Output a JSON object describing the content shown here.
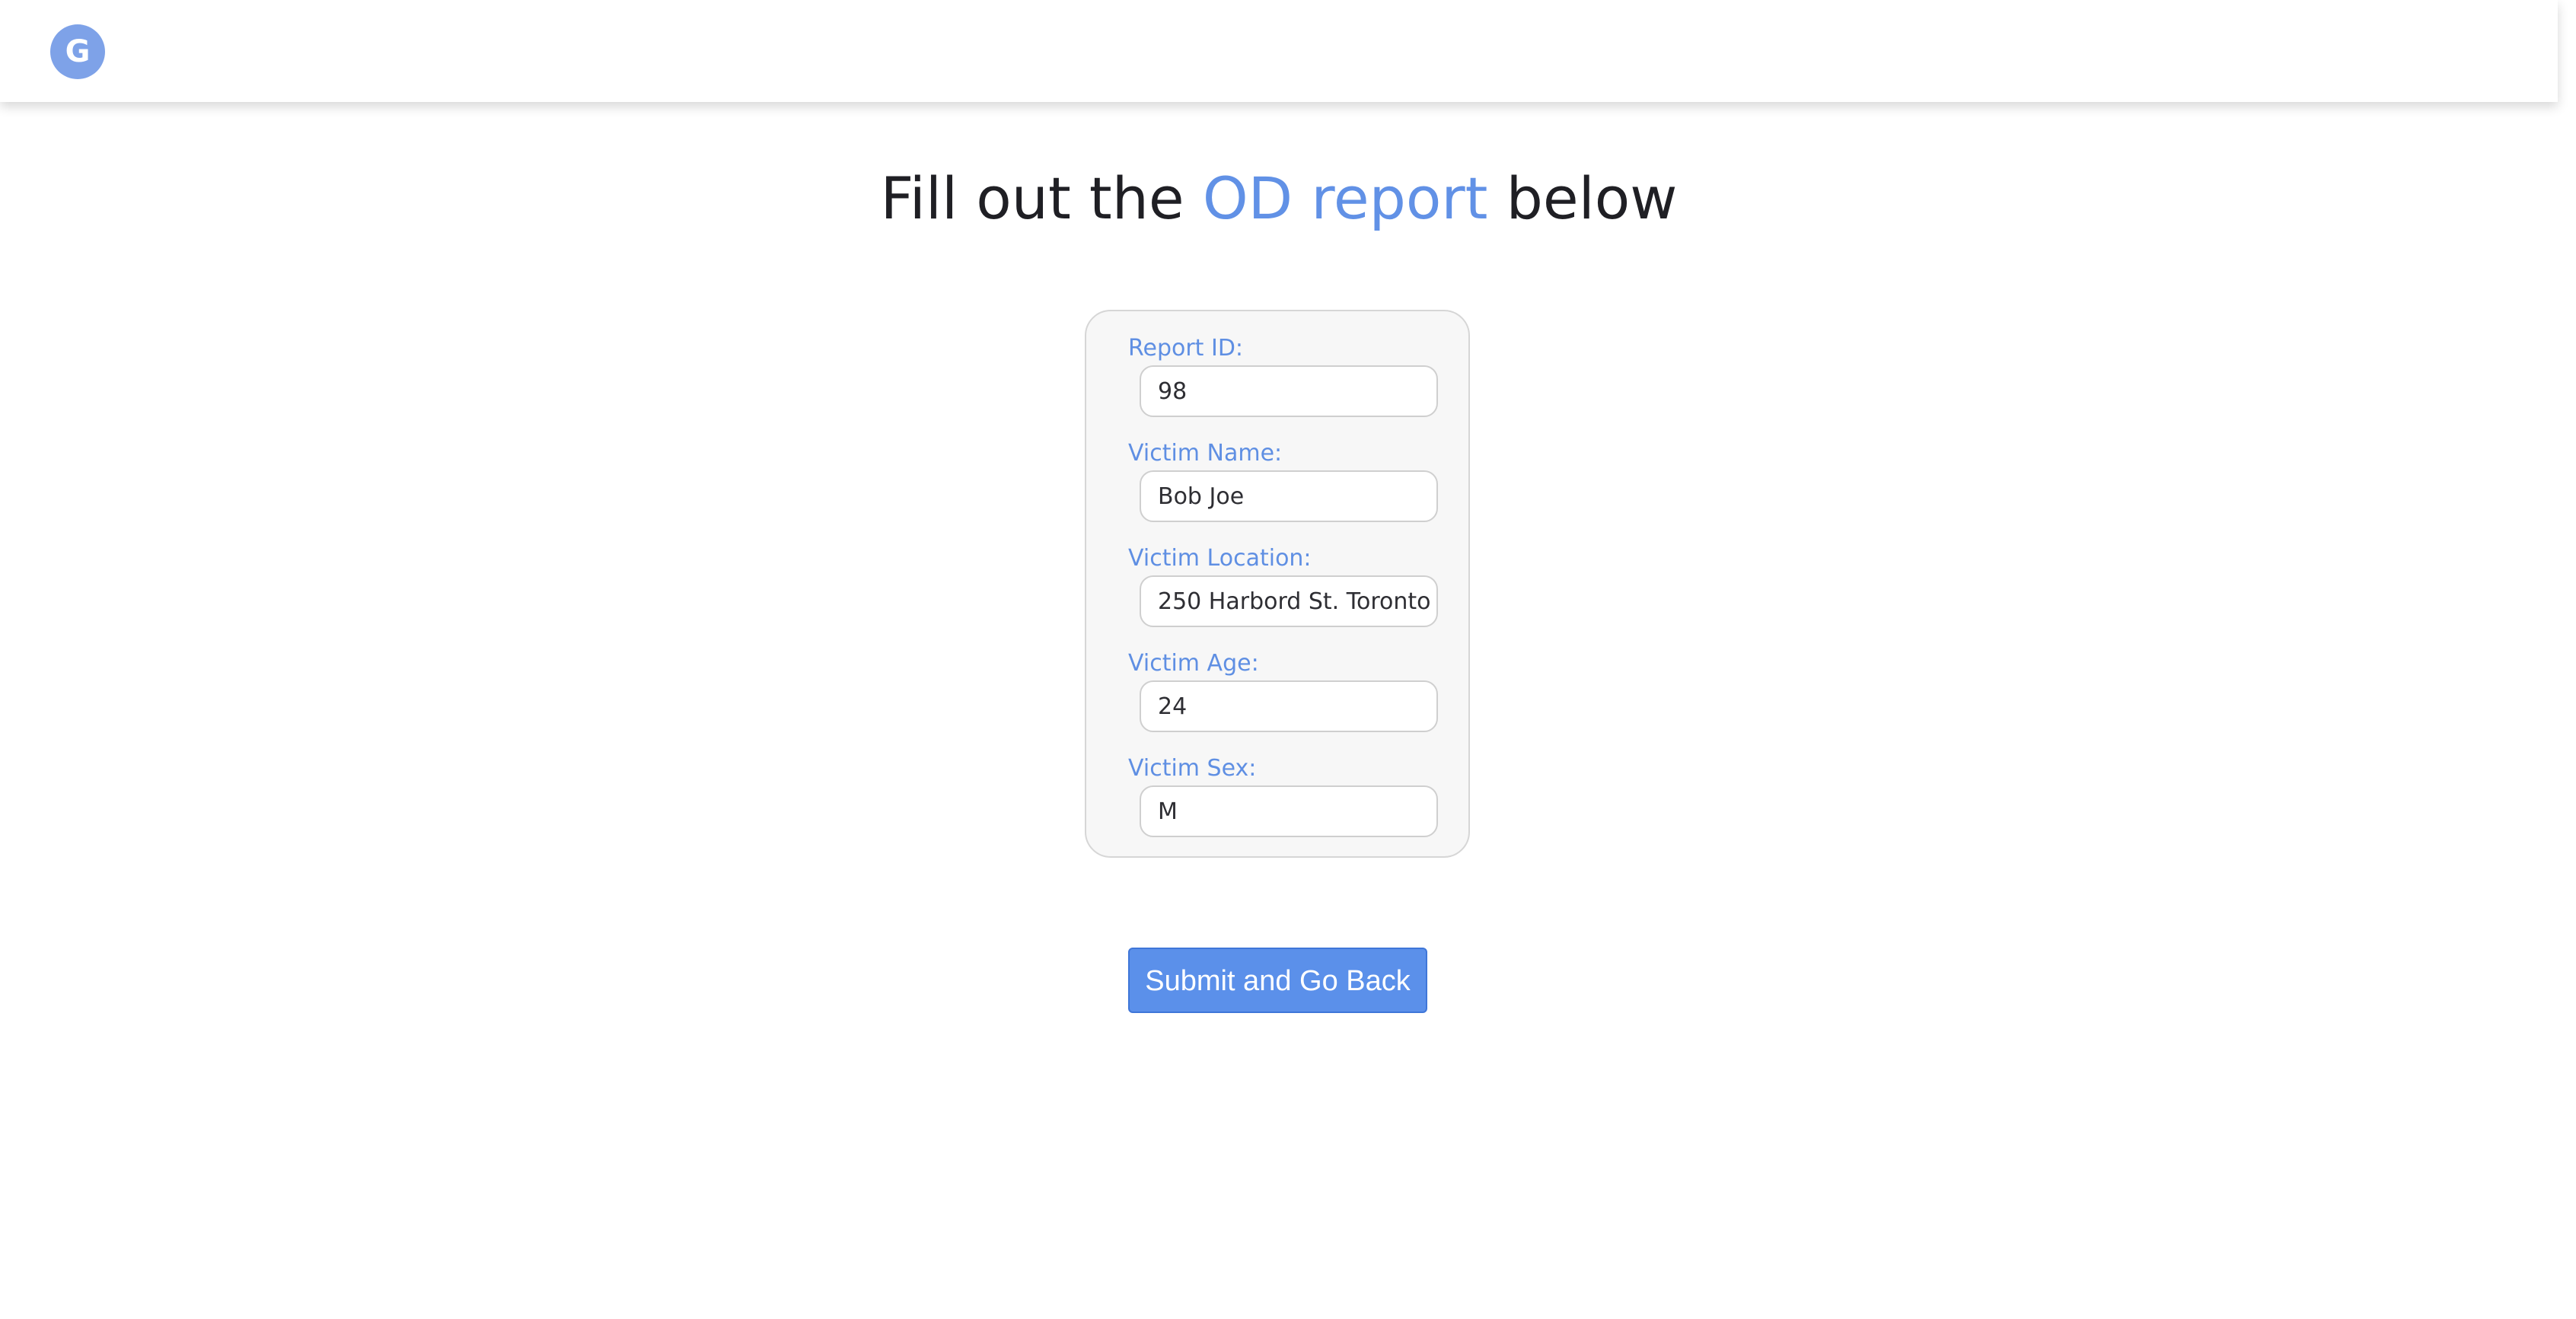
{
  "header": {
    "logo_letter": "G"
  },
  "heading": {
    "prefix": "Fill out the ",
    "accent": "OD report",
    "suffix": " below"
  },
  "form": {
    "fields": [
      {
        "label": "Report ID:",
        "value": "98"
      },
      {
        "label": "Victim Name:",
        "value": "Bob Joe"
      },
      {
        "label": "Victim Location:",
        "value": "250 Harbord St. Toronto"
      },
      {
        "label": "Victim Age:",
        "value": "24"
      },
      {
        "label": "Victim Sex:",
        "value": "M"
      }
    ]
  },
  "submit_label": "Submit and Go Back",
  "colors": {
    "accent": "#6191e6",
    "logo_bg": "#7ea2e8",
    "button_bg": "#5b90ea",
    "card_bg": "#f7f7f7"
  }
}
